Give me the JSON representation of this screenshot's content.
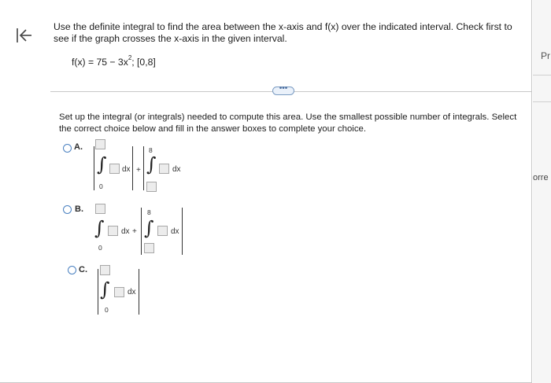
{
  "question": {
    "text": "Use the definite integral to find the area between the x-axis and f(x) over the indicated interval. Check first to see if the graph crosses the x-axis in the given interval.",
    "formula_prefix": "f(x) = 75 − 3x",
    "formula_exp": "2",
    "formula_suffix": "; [0,8]"
  },
  "more_button": {
    "label": "•••"
  },
  "instructions": "Set up the integral (or integrals) needed to compute this area. Use the smallest possible number of integrals. Select the correct choice below and fill in the answer boxes to complete your choice.",
  "choices": [
    {
      "letter": "A.",
      "lower1": "0",
      "upper2": "8",
      "dx": "dx",
      "plus": "+",
      "dx2": "dx"
    },
    {
      "letter": "B.",
      "lower1": "0",
      "upper2": "8",
      "dx": "dx",
      "plus": "+",
      "dx2": "dx"
    },
    {
      "letter": "C.",
      "lower1": "0",
      "dx": "dx"
    }
  ],
  "right_panel": {
    "top_label": "Pr",
    "mid_label": "orre"
  },
  "icons": {
    "back": "back-arrow-icon",
    "integral": "integral-sign"
  }
}
